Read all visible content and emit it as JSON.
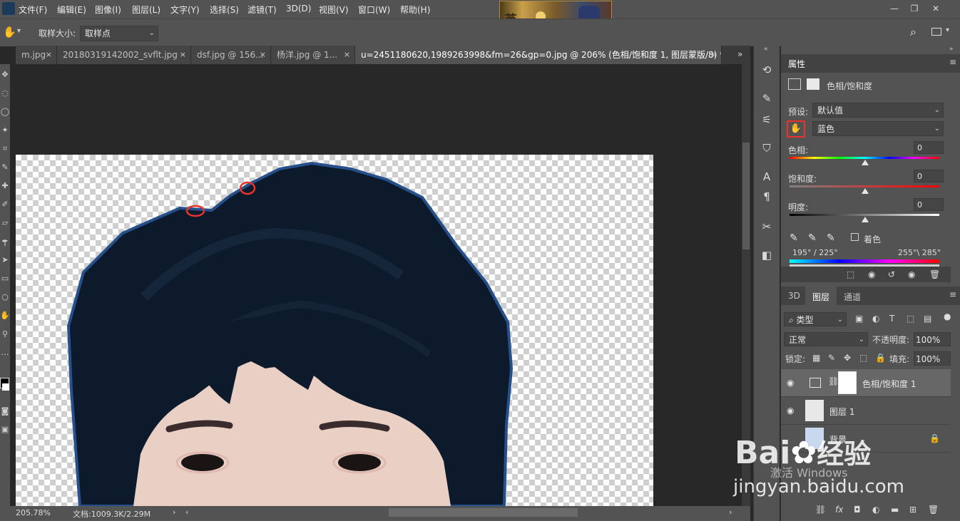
{
  "menu": [
    "文件(F)",
    "编辑(E)",
    "图像(I)",
    "图层(L)",
    "文字(Y)",
    "选择(S)",
    "滤镜(T)",
    "3D(D)",
    "视图(V)",
    "窗口(W)",
    "帮助(H)"
  ],
  "banner_text": "英",
  "options": {
    "sample_size_label": "取样大小:",
    "sample_size_value": "取样点"
  },
  "tabs": [
    {
      "label": "m.jpg"
    },
    {
      "label": "20180319142002_svflt.jpg"
    },
    {
      "label": "dsf.jpg @ 156..."
    },
    {
      "label": "杨洋.jpg @ 1..."
    },
    {
      "label": "u=2451180620,1989263998&fm=26&gp=0.jpg @ 206% (色相/饱和度 1, 图层蒙版/8) *"
    }
  ],
  "tab_close": "×",
  "status": {
    "zoom": "205.78%",
    "doc": "文档:1009.3K/2.29M"
  },
  "properties": {
    "tab": "属性",
    "adjustment_title": "色相/饱和度",
    "preset_label": "预设:",
    "preset_value": "默认值",
    "channel_value": "蓝色",
    "hue_label": "色相:",
    "hue_value": "0",
    "saturation_label": "饱和度:",
    "saturation_value": "0",
    "lightness_label": "明度:",
    "lightness_value": "0",
    "colorize_label": "着色",
    "range_left": "195° / 225°",
    "range_right": "255°\\ 285°"
  },
  "layers_panel": {
    "tabs": [
      "3D",
      "图层",
      "通道"
    ],
    "filter_value": "类型",
    "blend_mode": "正常",
    "opacity_label": "不透明度:",
    "opacity_value": "100%",
    "lock_label": "锁定:",
    "fill_label": "填充:",
    "fill_value": "100%",
    "layers": [
      {
        "name": "色相/饱和度 1"
      },
      {
        "name": "图层 1"
      },
      {
        "name": "背景"
      }
    ]
  },
  "watermark": {
    "brand": "Bai",
    "brand2": "经验",
    "url": "jingyan.baidu.com",
    "activate": "激活 Windows"
  },
  "colors": {
    "highlight": "#e8332a",
    "panel": "#535353",
    "canvas_bg": "#282828"
  }
}
